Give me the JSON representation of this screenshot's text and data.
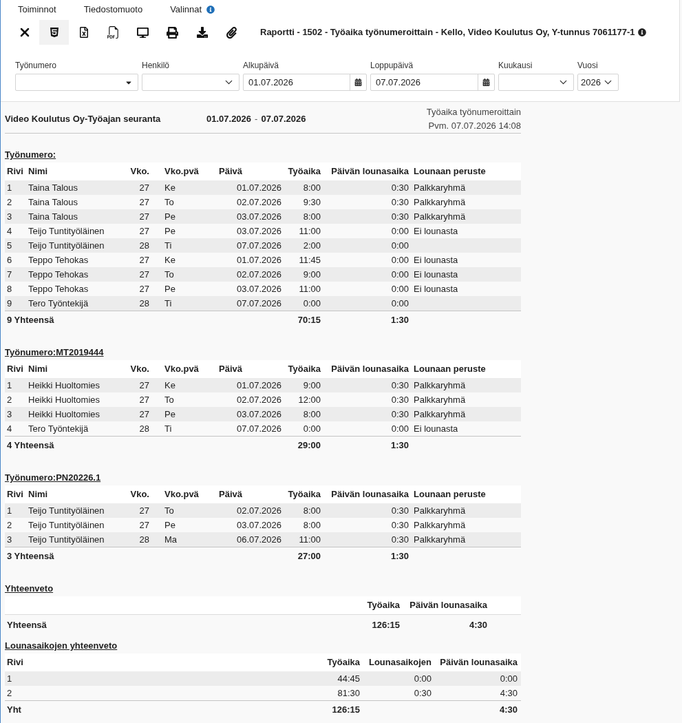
{
  "menu": [
    {
      "label": "Toiminnot",
      "info": false
    },
    {
      "label": "Tiedostomuoto",
      "info": false
    },
    {
      "label": "Valinnat",
      "info": true
    }
  ],
  "toolbar": {
    "buttons": [
      {
        "kind": "close",
        "selected": false
      },
      {
        "kind": "html",
        "selected": true
      },
      {
        "kind": "excel",
        "selected": false
      },
      {
        "kind": "pdf",
        "selected": false
      },
      {
        "kind": "screen",
        "selected": false
      },
      {
        "kind": "print",
        "selected": false
      },
      {
        "kind": "download",
        "selected": false
      },
      {
        "kind": "attach",
        "selected": false
      }
    ],
    "title": "Raportti - 1502 - Työaika työnumeroittain - Kello, Video Koulutus Oy, Y-tunnus 7061177-1",
    "title_info": true
  },
  "filters": [
    {
      "kind": "combo",
      "label": "Työnumero"
    },
    {
      "kind": "select",
      "label": "Henkilö"
    },
    {
      "kind": "date",
      "label": "Alkupäivä",
      "value": "01.07.2026"
    },
    {
      "kind": "date",
      "label": "Loppupäivä",
      "value": "07.07.2026"
    },
    {
      "kind": "select",
      "label": "Kuukausi"
    },
    {
      "kind": "select",
      "label": "Vuosi",
      "value": "2026"
    }
  ],
  "report": {
    "company_title": "Video Koulutus Oy-Työajan seuranta",
    "date_from": "01.07.2026",
    "date_separator": "-",
    "date_to": "07.07.2026",
    "report_name": "Työaika työnumeroittain",
    "printed": "Pvm. 07.07.2026 14:08"
  },
  "groups": [
    {
      "title": "Työnumero:",
      "columns": [
        "Rivi",
        "Nimi",
        "Vko.",
        "Vko.pvä",
        "Päivä",
        "Työaika",
        "Päivän lounasaika",
        "Lounaan peruste"
      ],
      "rows": [
        {
          "rivi": "1",
          "nimi": "Taina Talous",
          "vko": "27",
          "vko_pva": "Ke",
          "paiva": "01.07.2026",
          "tyoaika": "8:00",
          "lounasaika": "0:30",
          "peruste": "Palkkaryhmä"
        },
        {
          "rivi": "2",
          "nimi": "Taina Talous",
          "vko": "27",
          "vko_pva": "To",
          "paiva": "02.07.2026",
          "tyoaika": "9:30",
          "lounasaika": "0:30",
          "peruste": "Palkkaryhmä"
        },
        {
          "rivi": "3",
          "nimi": "Taina Talous",
          "vko": "27",
          "vko_pva": "Pe",
          "paiva": "03.07.2026",
          "tyoaika": "8:00",
          "lounasaika": "0:30",
          "peruste": "Palkkaryhmä"
        },
        {
          "rivi": "4",
          "nimi": "Teijo Tuntityöläinen",
          "vko": "27",
          "vko_pva": "Pe",
          "paiva": "03.07.2026",
          "tyoaika": "11:00",
          "lounasaika": "0:00",
          "peruste": "Ei lounasta"
        },
        {
          "rivi": "5",
          "nimi": "Teijo Tuntityöläinen",
          "vko": "28",
          "vko_pva": "Ti",
          "paiva": "07.07.2026",
          "tyoaika": "2:00",
          "lounasaika": "0:00"
        },
        {
          "rivi": "6",
          "nimi": "Teppo Tehokas",
          "vko": "27",
          "vko_pva": "Ke",
          "paiva": "01.07.2026",
          "tyoaika": "11:45",
          "lounasaika": "0:00",
          "peruste": "Ei lounasta"
        },
        {
          "rivi": "7",
          "nimi": "Teppo Tehokas",
          "vko": "27",
          "vko_pva": "To",
          "paiva": "02.07.2026",
          "tyoaika": "9:00",
          "lounasaika": "0:00",
          "peruste": "Ei lounasta"
        },
        {
          "rivi": "8",
          "nimi": "Teppo Tehokas",
          "vko": "27",
          "vko_pva": "Pe",
          "paiva": "03.07.2026",
          "tyoaika": "11:00",
          "lounasaika": "0:00",
          "peruste": "Ei lounasta"
        },
        {
          "rivi": "9",
          "nimi": "Tero Työntekijä",
          "vko": "28",
          "vko_pva": "Ti",
          "paiva": "07.07.2026",
          "tyoaika": "0:00",
          "lounasaika": "0:00"
        }
      ],
      "total": {
        "label": "9 Yhteensä",
        "tyoaika": "70:15",
        "lounasaika": "1:30"
      }
    },
    {
      "title": "Työnumero:MT2019444",
      "columns": [
        "Rivi",
        "Nimi",
        "Vko.",
        "Vko.pvä",
        "Päivä",
        "Työaika",
        "Päivän lounasaika",
        "Lounaan peruste"
      ],
      "rows": [
        {
          "rivi": "1",
          "nimi": "Heikki Huoltomies",
          "vko": "27",
          "vko_pva": "Ke",
          "paiva": "01.07.2026",
          "tyoaika": "9:00",
          "lounasaika": "0:30",
          "peruste": "Palkkaryhmä"
        },
        {
          "rivi": "2",
          "nimi": "Heikki Huoltomies",
          "vko": "27",
          "vko_pva": "To",
          "paiva": "02.07.2026",
          "tyoaika": "12:00",
          "lounasaika": "0:30",
          "peruste": "Palkkaryhmä"
        },
        {
          "rivi": "3",
          "nimi": "Heikki Huoltomies",
          "vko": "27",
          "vko_pva": "Pe",
          "paiva": "03.07.2026",
          "tyoaika": "8:00",
          "lounasaika": "0:30",
          "peruste": "Palkkaryhmä"
        },
        {
          "rivi": "4",
          "nimi": "Tero Työntekijä",
          "vko": "28",
          "vko_pva": "Ti",
          "paiva": "07.07.2026",
          "tyoaika": "0:00",
          "lounasaika": "0:00",
          "peruste": "Ei lounasta"
        }
      ],
      "total": {
        "label": "4 Yhteensä",
        "tyoaika": "29:00",
        "lounasaika": "1:30"
      }
    },
    {
      "title": "Työnumero:PN20226.1",
      "columns": [
        "Rivi",
        "Nimi",
        "Vko.",
        "Vko.pvä",
        "Päivä",
        "Työaika",
        "Päivän lounasaika",
        "Lounaan peruste"
      ],
      "rows": [
        {
          "rivi": "1",
          "nimi": "Teijo Tuntityöläinen",
          "vko": "27",
          "vko_pva": "To",
          "paiva": "02.07.2026",
          "tyoaika": "8:00",
          "lounasaika": "0:30",
          "peruste": "Palkkaryhmä"
        },
        {
          "rivi": "2",
          "nimi": "Teijo Tuntityöläinen",
          "vko": "27",
          "vko_pva": "Pe",
          "paiva": "03.07.2026",
          "tyoaika": "8:00",
          "lounasaika": "0:30",
          "peruste": "Palkkaryhmä"
        },
        {
          "rivi": "3",
          "nimi": "Teijo Tuntityöläinen",
          "vko": "28",
          "vko_pva": "Ma",
          "paiva": "06.07.2026",
          "tyoaika": "11:00",
          "lounasaika": "0:30",
          "peruste": "Palkkaryhmä"
        }
      ],
      "total": {
        "label": "3 Yhteensä",
        "tyoaika": "27:00",
        "lounasaika": "1:30"
      }
    }
  ],
  "summary": {
    "title": "Yhteenveto",
    "columns": [
      "Työaika",
      "Päivän lounasaika"
    ],
    "total": {
      "label": "Yhteensä",
      "tyoaika": "126:15",
      "lounasaika": "4:30"
    }
  },
  "lunch_summary": {
    "title": "Lounasaikojen yhteenveto",
    "columns": [
      "Rivi",
      "Työaika",
      "Lounasaikojen",
      "Päivän lounasaika"
    ],
    "rows": [
      {
        "rivi": "1",
        "tyoaika": "44:45",
        "lounasaikojen": "0:00",
        "lounasaika": "0:00"
      },
      {
        "rivi": "2",
        "tyoaika": "81:30",
        "lounasaikojen": "0:30",
        "lounasaika": "4:30"
      }
    ],
    "total": {
      "label": "Yht",
      "tyoaika": "126:15",
      "lounasaika": "4:30"
    }
  }
}
